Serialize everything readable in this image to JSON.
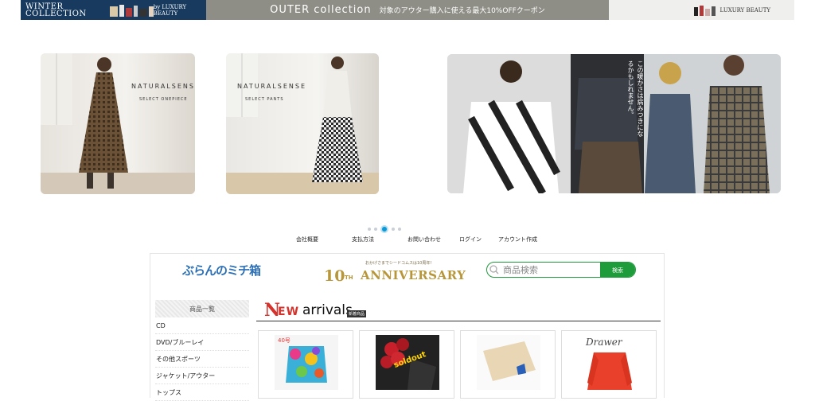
{
  "top_banner": {
    "left_title": "WINTER COLLECTION",
    "left_brand": "by LUXURY BEAUTY",
    "center_text": "OUTER collection",
    "center_sub": "対象のアウター購入に使える最大10%OFFクーポン",
    "right_brand": "LUXURY BEAUTY",
    "colors": {
      "left": "#173a5e",
      "center": "#8e8e86",
      "right": "#efefed"
    }
  },
  "carousel": {
    "slides": [
      {
        "title": "NATURALSENSE",
        "subtitle": "SELECT ONEPIECE"
      },
      {
        "title": "NATURALSENSE",
        "subtitle": "SELECT PANTS"
      },
      {
        "caption": "この暖かさは病みつきになるかもしれません。"
      }
    ],
    "dot_count": 5,
    "active_dot": 3
  },
  "nav": {
    "items": [
      {
        "label": "会社概要"
      },
      {
        "label": "支払方法"
      },
      {
        "label": "お問い合わせ"
      },
      {
        "label": "ログイン"
      },
      {
        "label": "アカウント作成"
      }
    ]
  },
  "header": {
    "logo_text": "ぶらんのミチ箱",
    "anniversary": {
      "top_text": "おかげさまでシードコムスは10周年!",
      "number": "10",
      "suffix": "TH",
      "word": "ANNIVERSARY"
    },
    "search": {
      "placeholder": "商品検索",
      "button_label": "検索",
      "accent": "#1e9b3b"
    }
  },
  "sidebar": {
    "heading": "商品一覧",
    "items": [
      {
        "label": "CD"
      },
      {
        "label": "DVD/ブルーレイ"
      },
      {
        "label": "その他スポーツ"
      },
      {
        "label": "ジャケット/アウター"
      },
      {
        "label": "トップス"
      }
    ]
  },
  "new_arrivals": {
    "title_N": "N",
    "title_EW": "EW",
    "title_rest": "arrivals",
    "tag": "新着商品",
    "products": [
      {
        "image": "colorful-top-40go",
        "label_overlay": "40号"
      },
      {
        "image": "roses-soldout",
        "label_overlay": "soldout"
      },
      {
        "image": "beige-knit",
        "label_overlay": ""
      },
      {
        "image": "red-sweater-drawer",
        "label_overlay": "Drawer"
      }
    ]
  }
}
